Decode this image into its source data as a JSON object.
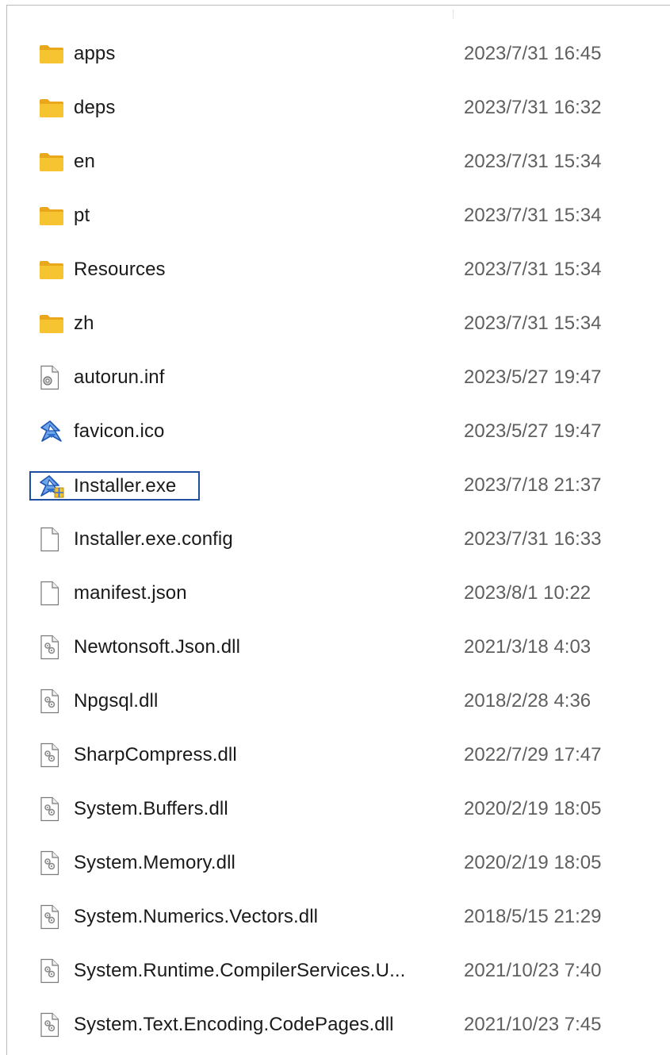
{
  "files": [
    {
      "name": "apps",
      "modified": "2023/7/31 16:45",
      "icon": "folder-icon"
    },
    {
      "name": "deps",
      "modified": "2023/7/31 16:32",
      "icon": "folder-icon"
    },
    {
      "name": "en",
      "modified": "2023/7/31 15:34",
      "icon": "folder-icon"
    },
    {
      "name": "pt",
      "modified": "2023/7/31 15:34",
      "icon": "folder-icon"
    },
    {
      "name": "Resources",
      "modified": "2023/7/31 15:34",
      "icon": "folder-icon"
    },
    {
      "name": "zh",
      "modified": "2023/7/31 15:34",
      "icon": "folder-icon"
    },
    {
      "name": "autorun.inf",
      "modified": "2023/5/27 19:47",
      "icon": "settings-file-icon"
    },
    {
      "name": "favicon.ico",
      "modified": "2023/5/27 19:47",
      "icon": "app-logo-icon"
    },
    {
      "name": "Installer.exe",
      "modified": "2023/7/18 21:37",
      "icon": "installer-exe-icon",
      "selected": true
    },
    {
      "name": "Installer.exe.config",
      "modified": "2023/7/31 16:33",
      "icon": "blank-file-icon"
    },
    {
      "name": "manifest.json",
      "modified": "2023/8/1 10:22",
      "icon": "blank-file-icon"
    },
    {
      "name": "Newtonsoft.Json.dll",
      "modified": "2021/3/18 4:03",
      "icon": "dll-file-icon"
    },
    {
      "name": "Npgsql.dll",
      "modified": "2018/2/28 4:36",
      "icon": "dll-file-icon"
    },
    {
      "name": "SharpCompress.dll",
      "modified": "2022/7/29 17:47",
      "icon": "dll-file-icon"
    },
    {
      "name": "System.Buffers.dll",
      "modified": "2020/2/19 18:05",
      "icon": "dll-file-icon"
    },
    {
      "name": "System.Memory.dll",
      "modified": "2020/2/19 18:05",
      "icon": "dll-file-icon"
    },
    {
      "name": "System.Numerics.Vectors.dll",
      "modified": "2018/5/15 21:29",
      "icon": "dll-file-icon"
    },
    {
      "name": "System.Runtime.CompilerServices.U...",
      "modified": "2021/10/23 7:40",
      "icon": "dll-file-icon"
    },
    {
      "name": "System.Text.Encoding.CodePages.dll",
      "modified": "2021/10/23 7:45",
      "icon": "dll-file-icon"
    }
  ],
  "colors": {
    "folder": "#f7c431",
    "selection_border": "#1f4fa3",
    "date_text": "#5f5f5f",
    "name_text": "#1a1a1a"
  }
}
